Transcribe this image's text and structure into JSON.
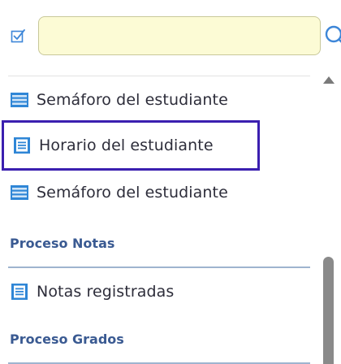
{
  "search": {
    "placeholder": "",
    "value": ""
  },
  "menu": {
    "items": [
      {
        "kind": "item",
        "icon": "list-table-icon",
        "label": "Semáforo del estudiante"
      },
      {
        "kind": "item",
        "icon": "document-icon",
        "label": "Horario del estudiante",
        "selected": true
      },
      {
        "kind": "item",
        "icon": "list-table-icon",
        "label": "Semáforo del estudiante"
      },
      {
        "kind": "section",
        "label": "Proceso Notas"
      },
      {
        "kind": "item",
        "icon": "document-icon",
        "label": "Notas registradas"
      },
      {
        "kind": "section",
        "label": "Proceso Grados"
      }
    ]
  },
  "colors": {
    "accent": "#3b1fb0",
    "icon_blue": "#2f86d6",
    "section_text": "#3a5a92",
    "search_bg": "#fcfbd5"
  }
}
